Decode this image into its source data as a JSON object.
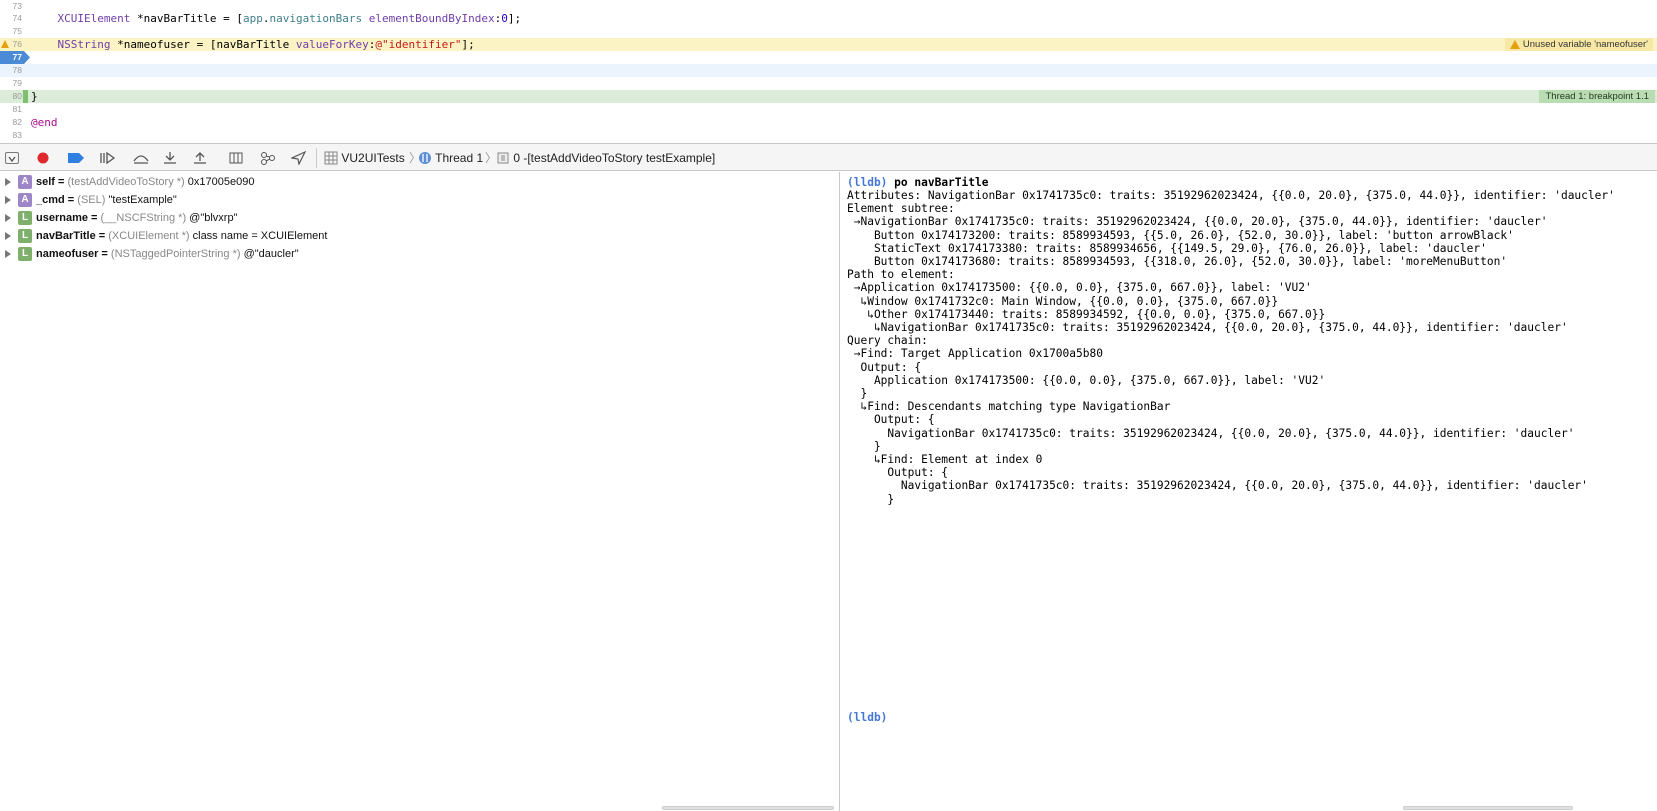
{
  "editor": {
    "lines": [
      {
        "num": "73",
        "code": ""
      },
      {
        "num": "74",
        "code": "    XCUIElement *navBarTitle = [app.navigationBars elementBoundByIndex:0];"
      },
      {
        "num": "75",
        "code": ""
      },
      {
        "num": "76",
        "code": "    NSString *nameofuser = [navBarTitle valueForKey:@\"identifier\"];"
      },
      {
        "num": "77",
        "code": ""
      },
      {
        "num": "78",
        "code": ""
      },
      {
        "num": "79",
        "code": ""
      },
      {
        "num": "80",
        "code": "}"
      },
      {
        "num": "81",
        "code": ""
      },
      {
        "num": "82",
        "code": "@end"
      },
      {
        "num": "83",
        "code": ""
      }
    ],
    "warning_badge": "Unused variable 'nameofuser'",
    "thread_badge": "Thread 1: breakpoint 1.1"
  },
  "debug_bar": {
    "breadcrumbs": [
      "VU2UITests",
      "Thread 1",
      "0 -[testAddVideoToStory testExample]"
    ]
  },
  "variables": [
    {
      "kind": "A",
      "name": "self",
      "type": "(testAddVideoToStory *)",
      "value": "0x17005e090"
    },
    {
      "kind": "A",
      "name": "_cmd",
      "type": "(SEL)",
      "value": "\"testExample\""
    },
    {
      "kind": "L",
      "name": "username",
      "type": "(__NSCFString *)",
      "value": "@\"blvxrp\""
    },
    {
      "kind": "L",
      "name": "navBarTitle",
      "type": "(XCUIElement *)",
      "value": "class name = XCUIElement"
    },
    {
      "kind": "L",
      "name": "nameofuser",
      "type": "(NSTaggedPointerString *)",
      "value": "@\"daucler\""
    }
  ],
  "console": {
    "prompt": "(lldb)",
    "command": "po navBarTitle",
    "output": [
      "Attributes: NavigationBar 0x1741735c0: traits: 35192962023424, {{0.0, 20.0}, {375.0, 44.0}}, identifier: 'daucler'",
      "Element subtree:",
      " →NavigationBar 0x1741735c0: traits: 35192962023424, {{0.0, 20.0}, {375.0, 44.0}}, identifier: 'daucler'",
      "    Button 0x174173200: traits: 8589934593, {{5.0, 26.0}, {52.0, 30.0}}, label: 'button arrowBlack'",
      "    StaticText 0x174173380: traits: 8589934656, {{149.5, 29.0}, {76.0, 26.0}}, label: 'daucler'",
      "    Button 0x174173680: traits: 8589934593, {{318.0, 26.0}, {52.0, 30.0}}, label: 'moreMenuButton'",
      "Path to element:",
      " →Application 0x174173500: {{0.0, 0.0}, {375.0, 667.0}}, label: 'VU2'",
      "  ↳Window 0x1741732c0: Main Window, {{0.0, 0.0}, {375.0, 667.0}}",
      "   ↳Other 0x174173440: traits: 8589934592, {{0.0, 0.0}, {375.0, 667.0}}",
      "    ↳NavigationBar 0x1741735c0: traits: 35192962023424, {{0.0, 20.0}, {375.0, 44.0}}, identifier: 'daucler'",
      "Query chain:",
      " →Find: Target Application 0x1700a5b80",
      "  Output: {",
      "    Application 0x174173500: {{0.0, 0.0}, {375.0, 667.0}}, label: 'VU2'",
      "  }",
      "  ↳Find: Descendants matching type NavigationBar",
      "    Output: {",
      "      NavigationBar 0x1741735c0: traits: 35192962023424, {{0.0, 20.0}, {375.0, 44.0}}, identifier: 'daucler'",
      "    }",
      "    ↳Find: Element at index 0",
      "      Output: {",
      "        NavigationBar 0x1741735c0: traits: 35192962023424, {{0.0, 20.0}, {375.0, 44.0}}, identifier: 'daucler'",
      "      }"
    ],
    "final_prompt": "(lldb)"
  }
}
